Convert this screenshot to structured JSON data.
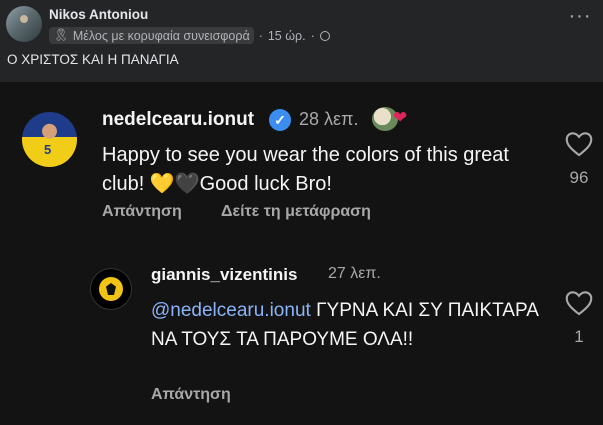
{
  "post": {
    "author": "Nikos Antoniou",
    "badge": "Μέλος με κορυφαία συνεισφορά",
    "separator": "·",
    "time": "15 ώρ.",
    "separator2": "·",
    "text": "Ο ΧΡΙΣΤΟΣ ΚΑΙ Η ΠΑΝΑΓΙΑ"
  },
  "comment": {
    "username": "nedelcearu.ionut",
    "time": "28 λεπ.",
    "text_before": "Happy to see you wear the colors of this great club! ",
    "emoji1": "💛",
    "emoji2": "🖤",
    "text_after": "Good luck Bro!",
    "reply_label": "Απάντηση",
    "translate_label": "Δείτε τη μετάφραση",
    "likes": "96"
  },
  "reply": {
    "username": "giannis_vizentinis",
    "time": "27 λεπ.",
    "mention": "@nedelcearu.ionut",
    "text": " ΓΥΡΝΑ ΚΑΙ ΣΥ ΠΑΙΚΤΑΡΑ ΝΑ ΤΟΥΣ ΤΑ ΠΑΡΟΥΜΕ ΟΛΑ!!",
    "reply_label": "Απάντηση",
    "likes": "1"
  },
  "icons": {
    "more": "more-icon",
    "globe": "globe-icon",
    "verified": "verified-icon",
    "heart": "heart-icon"
  },
  "colors": {
    "fb_bg": "#242526",
    "ig_bg": "#131313",
    "mention": "#8ab4f8",
    "verified": "#3b8ef0"
  }
}
